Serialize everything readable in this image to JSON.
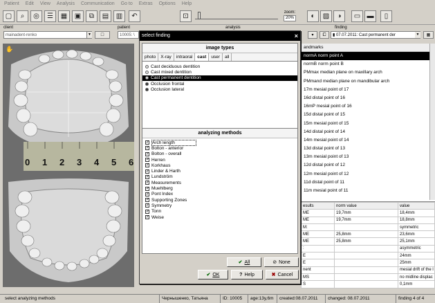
{
  "menu": [
    "Patient",
    "Edit",
    "View",
    "Analysis",
    "Communication",
    "Go to",
    "Extras",
    "Options",
    "Help"
  ],
  "toolbar": {
    "zoom_label": "zoom:",
    "zoom_value": "20%"
  },
  "header": {
    "client_label": "client",
    "client_value": "mainadent-renko",
    "patient_label": "patient",
    "patient_value": "10005: \\",
    "analysis_label": "analysis",
    "finding_label": "finding",
    "finding_value": "07.07.2011: Cast permanent der"
  },
  "dialog": {
    "title": "select finding",
    "close": "×",
    "image_types_title": "image types",
    "tabs": [
      "photo",
      "X-ray",
      "intraoral",
      "cast",
      "user",
      "all"
    ],
    "active_tab": "cast",
    "image_items": [
      "Cast deciduous dentition",
      "Cast mixed dentition",
      "Cast permanent dentition",
      "Occlusion frontal",
      "Occlusion lateral"
    ],
    "selected_image_item": "Cast permanent dentition",
    "methods_title": "analyzing methods",
    "methods": [
      "Arch length",
      "Bolton - anterior",
      "Bolton - overall",
      "Herren",
      "Korkhaus",
      "Linder & Harth",
      "Lundström",
      "Measurements",
      "Muehlberg",
      "Pont Index",
      "Supporting Zones",
      "Symmetry",
      "Tonn",
      "Weise"
    ],
    "all_label": "All",
    "none_label": "None",
    "ok_label": "OK",
    "help_label": "Help",
    "cancel_label": "Cancel"
  },
  "landmarks": {
    "header": "andmarks",
    "items": [
      "normA norm point A",
      "normB norm point B",
      "PMmax median plane on maxillary arch",
      "PMmand median plane on mandibular arch",
      "17m mesial point of 17",
      "16d distal point of 16",
      "16mP mesial point of 16",
      "15d distal point of 15",
      "15m mesial point of 15",
      "14d distal point of 14",
      "14m mesial point of 14",
      "13d distal point of 13",
      "13m mesial point of 13",
      "12d distal point of 12",
      "12m mesial point of 12",
      "11d distal point of 11",
      "11m mesial point of 11"
    ],
    "selected_index": 0
  },
  "results": {
    "columns": [
      "esults",
      "norm value",
      "value"
    ],
    "rows": [
      [
        "ME",
        "19,7mm",
        "18,4mm"
      ],
      [
        "ME",
        "19,7mm",
        "18,8mm"
      ],
      [
        "M:",
        "",
        "symmetric"
      ],
      [
        "ME",
        "25,8mm",
        "23,6mm"
      ],
      [
        "ME",
        "25,8mm",
        "25,1mm"
      ],
      [
        ":",
        "",
        "asymmetric"
      ],
      [
        "E",
        "",
        "24mm"
      ],
      [
        "E",
        "",
        "25mm"
      ],
      [
        "nent",
        "",
        "mesial drift of the l"
      ],
      [
        "MS",
        "",
        "no midline displac"
      ],
      [
        "S",
        "",
        "0,1mm"
      ]
    ]
  },
  "status": {
    "message": "select analyzing methods",
    "patient_name": "Чернышенко, Татьяна",
    "id": "ID: 10005",
    "age": "age:13y,6m",
    "created": "created:08.07.2011",
    "changed": "changed: 08.07.2011",
    "finding": "finding 4 of 4"
  },
  "ruler_labels": [
    "0",
    "1",
    "2",
    "3",
    "4",
    "5",
    "6"
  ]
}
